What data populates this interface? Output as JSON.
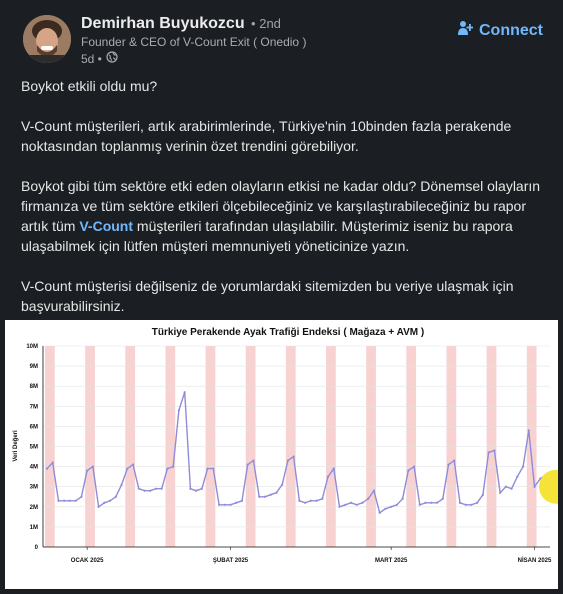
{
  "author": {
    "name": "Demirhan Buyukozcu",
    "degree": "• 2nd",
    "headline": "Founder & CEO of V-Count Exit ( Onedio )",
    "time": "5d •",
    "connect_label": "Connect"
  },
  "post": {
    "p1": "Boykot etkili oldu mu?",
    "p2": "V-Count müşterileri, artık arabirimlerinde, Türkiye'nin 10binden fazla perakende noktasından toplanmış verinin özet trendini görebiliyor.",
    "p3_before": "Boykot gibi tüm sektöre etki eden olayların etkisi ne kadar oldu? Dönemsel olayların firmanıza ve tüm sektöre etkileri ölçebileceğiniz ve karşılaştırabileceğiniz bu rapor artık tüm ",
    "p3_mention": "V-Count",
    "p3_after": " müşterileri tarafından ulaşılabilir. Müşterimiz iseniz bu rapora ulaşabilmek için lütfen müşteri memnuniyeti yöneticinize yazın.",
    "p4": "V-Count müşterisi değilseniz de yorumlardaki sitemizden bu veriye ulaşmak için başvurabilirsiniz."
  },
  "chart_data": {
    "type": "line",
    "title": "Türkiye Perakende Ayak Trafiği Endeksi ( Mağaza + AVM )",
    "ylabel": "Veri Değeri",
    "ylim": [
      0,
      10
    ],
    "yticks": [
      "0",
      "1M",
      "2M",
      "3M",
      "4M",
      "5M",
      "6M",
      "7M",
      "8M",
      "9M",
      "10M"
    ],
    "xticks": [
      "OCAK 2025",
      "ŞUBAT 2025",
      "MART 2025",
      "NİSAN 2025"
    ],
    "grid": true,
    "line_color": "#8f8cd9",
    "band_color": "#f7c9c9",
    "highlight_color": "#f5e33a",
    "series": [
      {
        "values": [
          3.9,
          4.2,
          2.3,
          2.3,
          2.3,
          2.3,
          2.5,
          3.8,
          4.0,
          2.0,
          2.2,
          2.3,
          2.5,
          3.1,
          3.9,
          4.1,
          2.9,
          2.8,
          2.8,
          2.9,
          2.9,
          3.9,
          4.0,
          6.8,
          7.7,
          2.9,
          2.8,
          2.9,
          3.9,
          3.9,
          2.1,
          2.1,
          2.1,
          2.2,
          2.3,
          4.1,
          4.3,
          2.5,
          2.5,
          2.6,
          2.7,
          3.1,
          4.3,
          4.5,
          2.3,
          2.2,
          2.3,
          2.3,
          2.4,
          3.5,
          3.9,
          2.0,
          2.1,
          2.2,
          2.1,
          2.2,
          2.4,
          2.8,
          1.7,
          1.9,
          2.0,
          2.1,
          2.4,
          3.8,
          4.0,
          2.1,
          2.2,
          2.2,
          2.2,
          2.4,
          4.1,
          4.3,
          2.2,
          2.1,
          2.1,
          2.2,
          2.6,
          4.7,
          4.8,
          2.7,
          3.0,
          2.9,
          3.5,
          4.0,
          5.8,
          3.0,
          3.4,
          3.6
        ]
      }
    ]
  }
}
